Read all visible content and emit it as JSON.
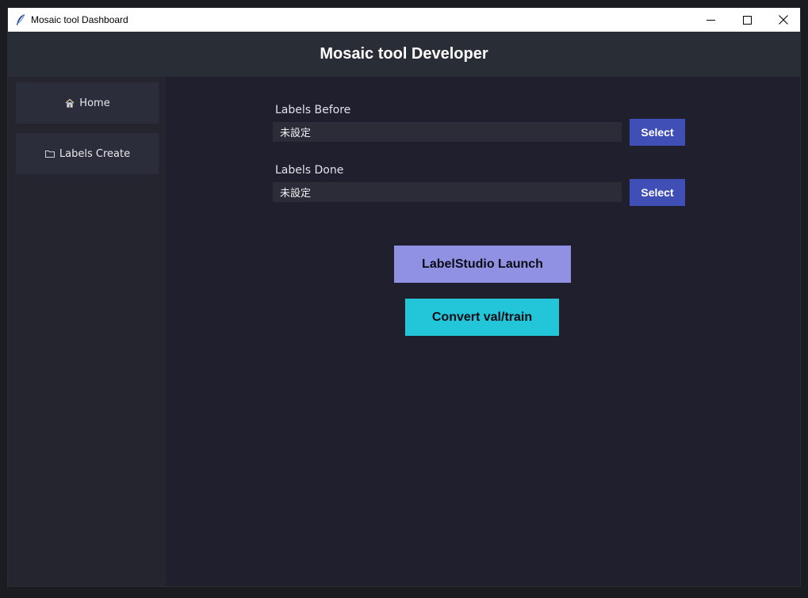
{
  "window": {
    "title": "Mosaic tool Dashboard",
    "icon": "feather-icon",
    "controls": [
      "minimize-icon",
      "maximize-icon",
      "close-icon"
    ]
  },
  "header": {
    "title": "Mosaic tool Developer"
  },
  "sidebar": {
    "items": [
      {
        "label": "Home",
        "icon": "house-icon"
      },
      {
        "label": "Labels Create",
        "icon": "folder-icon"
      }
    ]
  },
  "main": {
    "labels_before": {
      "label": "Labels Before",
      "value": "未設定",
      "button": "Select"
    },
    "labels_done": {
      "label": "Labels Done",
      "value": "未設定",
      "button": "Select"
    },
    "launch_button": "LabelStudio Launch",
    "convert_button": "Convert val/train"
  },
  "colors": {
    "background": "#1f1f2e",
    "header": "#292d36",
    "sidebar": "#24252e",
    "nav_button": "#2c2d3a",
    "select_button": "#3f4fb5",
    "launch_button": "#9091e2",
    "convert_button": "#23c5d8"
  }
}
